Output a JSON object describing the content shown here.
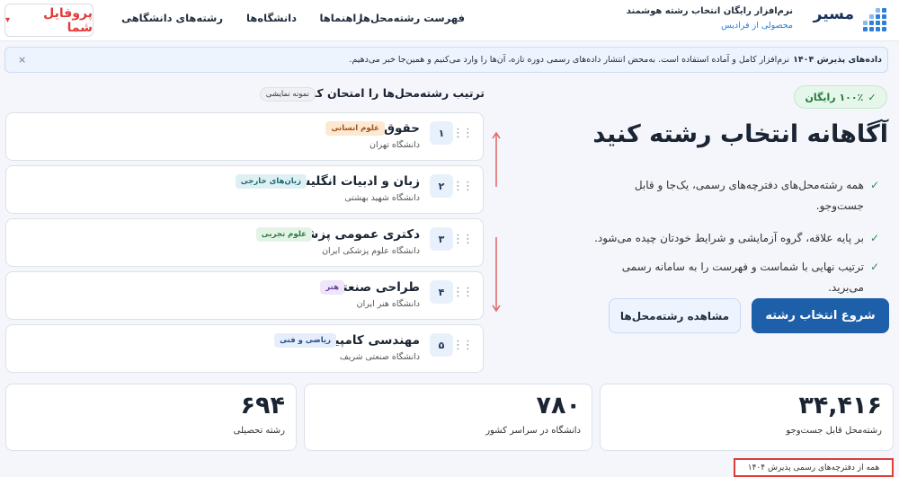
{
  "header": {
    "brand": "مسیر",
    "tagline": "نرم‌افزار رایگان انتخاب رشته هوشمند",
    "sub": "محصولی از فرادیس",
    "nav": [
      "فهرست رشته‌محل‌ها",
      "راهنماها",
      "دانشگاه‌ها",
      "رشته‌های دانشگاهی"
    ],
    "profile_label": "پروفایل شما"
  },
  "notice": {
    "bold": "داده‌های پذیرش ۱۴۰۴",
    "text": "نرم‌افزار کامل و آماده استفاده است. به‌محض انتشار داده‌های رسمی دوره تازه، آن‌ها را وارد می‌کنیم و همین‌جا خبر می‌دهیم.",
    "close": "×"
  },
  "hero": {
    "badge": "۱۰۰٪ رایگان",
    "title": "آگاهانه انتخاب رشته کنید",
    "features": [
      "همه رشته‌محل‌های دفترچه‌های رسمی، یک‌جا و قابل جست‌وجو.",
      "بر پایه علاقه، گروه آزمایشی و شرایط خودتان چیده می‌شود.",
      "ترتیب نهایی با شماست و فهرست را به سامانه رسمی می‌برید."
    ],
    "start_button": "شروع انتخاب رشته",
    "view_button": "مشاهده رشته‌محل‌ها"
  },
  "demo": {
    "title": "ترتیب رشته‌محل‌ها را امتحان کنید",
    "tag": "نمونه نمایشی",
    "items": [
      {
        "num": "۱",
        "name": "حقوق",
        "uni": "دانشگاه تهران",
        "tag": "علوم انسانی"
      },
      {
        "num": "۲",
        "name": "زبان و ادبیات انگلیسی",
        "uni": "دانشگاه شهید بهشتی",
        "tag": "زبان‌های خارجی"
      },
      {
        "num": "۳",
        "name": "دکتری عمومی پزشکی",
        "uni": "دانشگاه علوم پزشکی ایران",
        "tag": "علوم تجربی"
      },
      {
        "num": "۴",
        "name": "طراحی صنعتی",
        "uni": "دانشگاه هنر ایران",
        "tag": "هنر"
      },
      {
        "num": "۵",
        "name": "مهندسی کامپیوتر",
        "uni": "دانشگاه صنعتی شریف",
        "tag": "ریاضی و فنی"
      }
    ]
  },
  "stats": [
    {
      "value": "۳۴,۴۱۶",
      "label": "رشته‌محل قابل جست‌وجو"
    },
    {
      "value": "۷۸۰",
      "label": "دانشگاه در سراسر کشور"
    },
    {
      "value": "۶۹۴",
      "label": "رشته تحصیلی"
    }
  ],
  "footnote": "همه از دفترچه‌های رسمی پذیرش ۱۴۰۴",
  "colors": {
    "primary": "#1d5fa9",
    "accent_red": "#e03b3b",
    "success": "#1f7a3a"
  }
}
